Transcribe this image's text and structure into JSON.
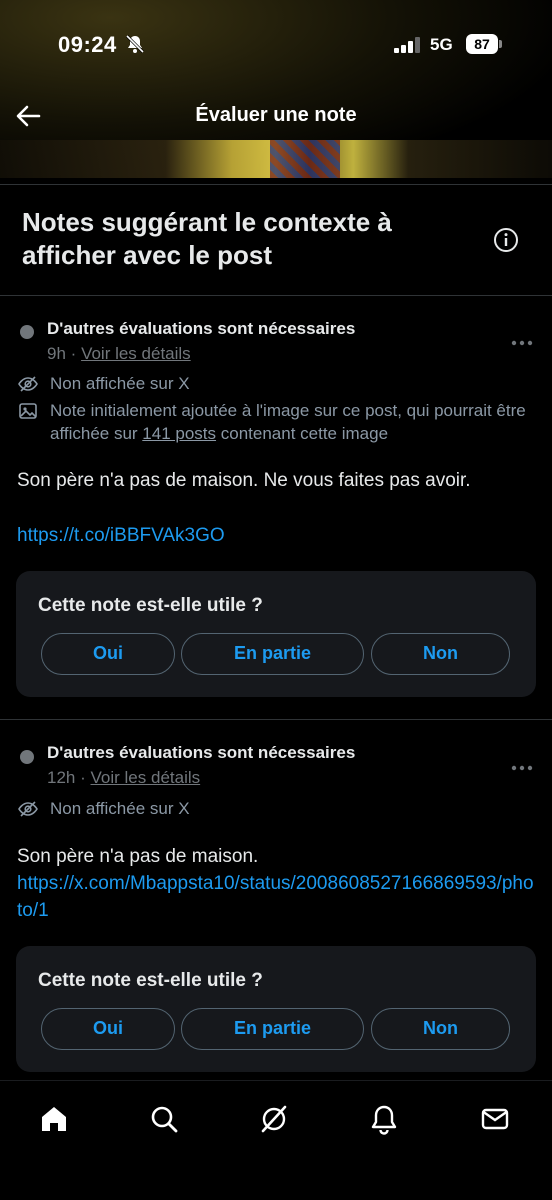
{
  "status_bar": {
    "time": "09:24",
    "network": "5G",
    "battery": "87"
  },
  "nav": {
    "title": "Évaluer une note"
  },
  "section": {
    "title": "Notes suggérant le contexte à afficher avec le post"
  },
  "notes": [
    {
      "status": "D'autres évaluations sont nécessaires",
      "age": "9h",
      "separator": "·",
      "details_link": "Voir les détails",
      "visibility": "Non affichée sur X",
      "image_note_pre": "Note initialement ajoutée à l'image sur ce post, qui pourrait être affichée sur ",
      "image_note_link": "141 posts",
      "image_note_post": " contenant cette image",
      "text": "Son père n'a pas de maison. Ne vous faites pas avoir.",
      "url": "https://t.co/iBBFVAk3GO",
      "vote": {
        "question": "Cette note est-elle utile ?",
        "yes": "Oui",
        "partial": "En partie",
        "no": "Non"
      }
    },
    {
      "status": "D'autres évaluations sont nécessaires",
      "age": "12h",
      "separator": "·",
      "details_link": "Voir les détails",
      "visibility": "Non affichée sur X",
      "text": "Son père n'a pas de maison.",
      "url": "https://x.com/Mbappsta10/status/2008608527166869593/photo/1",
      "vote": {
        "question": "Cette note est-elle utile ?",
        "yes": "Oui",
        "partial": "En partie",
        "no": "Non"
      }
    }
  ],
  "tabbar": {
    "icons": [
      "home-icon",
      "search-icon",
      "grok-icon",
      "notifications-icon",
      "messages-icon"
    ]
  },
  "colors": {
    "accent": "#1d9bf0",
    "muted": "#71767b",
    "card": "#16181c",
    "background": "#000000"
  }
}
